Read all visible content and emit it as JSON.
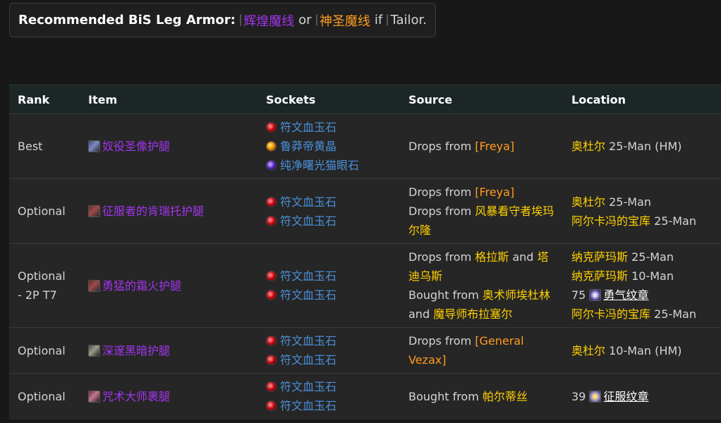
{
  "recommendation": {
    "lead": "Recommended BiS Leg Armor:",
    "option1": "辉煌魔线",
    "or": "or",
    "option2": "神圣魔线",
    "if": "if",
    "tailor": "Tailor."
  },
  "table": {
    "headers": [
      "Rank",
      "Item",
      "Sockets",
      "Source",
      "Location"
    ],
    "rows": [
      {
        "rank": "Best",
        "item": "奴役圣像护腿",
        "sockets": [
          "符文血玉石",
          "鲁莽帝黄晶",
          "纯净曙光猫眼石"
        ],
        "source": [
          {
            "prefix": "Drops from",
            "name": "[Freya]"
          }
        ],
        "location": [
          {
            "place": "奥杜尔",
            "suffix": "25-Man (HM)"
          }
        ]
      },
      {
        "rank": "Optional",
        "item": "征服者的肯瑞托护腿",
        "sockets": [
          "符文血玉石",
          "符文血玉石"
        ],
        "source": [
          {
            "prefix": "Drops from",
            "name": "[Freya]"
          },
          {
            "prefix": "Drops from",
            "name": "风暴看守者埃玛尔隆"
          }
        ],
        "location": [
          {
            "place": "奥杜尔",
            "suffix": "25-Man"
          },
          {
            "place": "阿尔卡冯的宝库",
            "suffix": "25-Man"
          }
        ]
      },
      {
        "rank": "Optional - 2P T7",
        "item": "勇猛的霜火护腿",
        "sockets": [
          "符文血玉石",
          "符文血玉石"
        ],
        "source_text": {
          "l1_prefix": "Drops from",
          "l1_a": "格拉斯",
          "l1_and": "and",
          "l1_b": "塔",
          "l2_b": "迪乌斯",
          "l3_prefix": "Bought from",
          "l3_a": "奥术师埃杜林",
          "l4_and": "and",
          "l4_b": "魔导师布拉塞尔"
        },
        "location_text": {
          "l1_place": "纳克萨玛斯",
          "l1_suffix": "25-Man",
          "l2_place": "纳克萨玛斯",
          "l2_suffix": "10-Man",
          "l3_count": "75",
          "l3_currency": "勇气纹章",
          "l4_place": "阿尔卡冯的宝库",
          "l4_suffix": "25-Man"
        }
      },
      {
        "rank": "Optional",
        "item": "深邃黑暗护腿",
        "sockets": [
          "符文血玉石",
          "符文血玉石"
        ],
        "source": [
          {
            "prefix": "Drops from",
            "name": "[General Vezax]"
          }
        ],
        "location": [
          {
            "place": "奥杜尔",
            "suffix": "10-Man (HM)"
          }
        ]
      },
      {
        "rank": "Optional",
        "item": "咒术大师裹腿",
        "sockets": [
          "符文血玉石",
          "符文血玉石"
        ],
        "source": [
          {
            "prefix": "Bought from",
            "name": "帕尔蒂丝"
          }
        ],
        "location_currency": {
          "count": "39",
          "currency": "征服纹章"
        }
      }
    ]
  },
  "icons": {
    "option1": "spellthread-icon",
    "option2": "spellthread-icon",
    "tailor": "tailoring-icon"
  },
  "colors": {
    "epic": "#a335ee",
    "legendary": "#ff9d1f",
    "npc": "#ffd100",
    "gem_link": "#4a90d9"
  }
}
